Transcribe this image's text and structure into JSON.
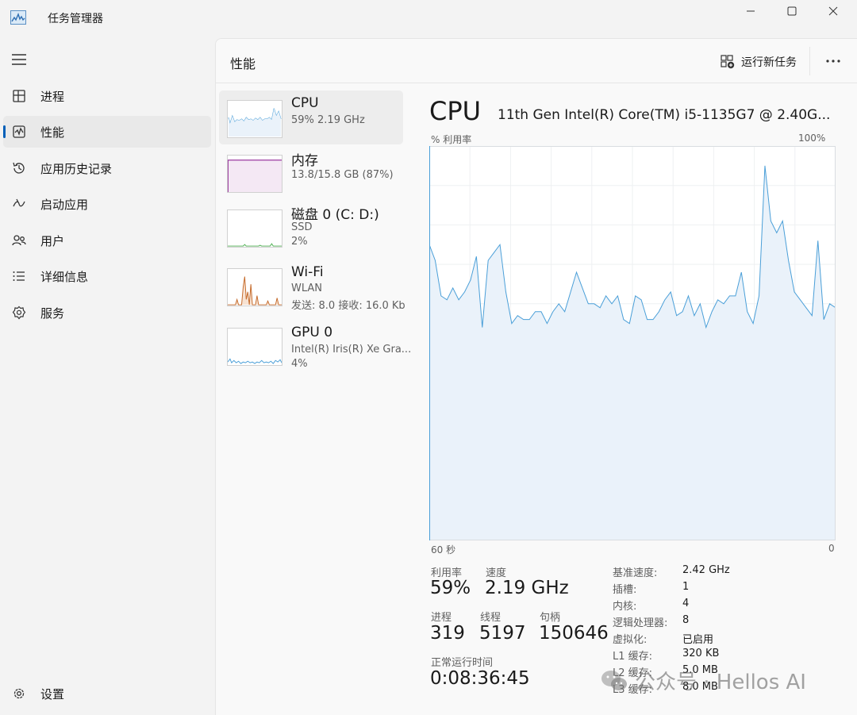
{
  "window": {
    "title": "任务管理器",
    "min_icon": "minimize-icon",
    "max_icon": "maximize-icon",
    "close_icon": "close-icon"
  },
  "sidebar": {
    "items": [
      {
        "label": "进程",
        "icon": "processes-icon"
      },
      {
        "label": "性能",
        "icon": "performance-icon",
        "active": true
      },
      {
        "label": "应用历史记录",
        "icon": "history-icon"
      },
      {
        "label": "启动应用",
        "icon": "startup-icon"
      },
      {
        "label": "用户",
        "icon": "users-icon"
      },
      {
        "label": "详细信息",
        "icon": "details-icon"
      },
      {
        "label": "服务",
        "icon": "services-icon"
      }
    ],
    "settings_label": "设置"
  },
  "header": {
    "title": "性能",
    "run_task_label": "运行新任务",
    "more_label": "···"
  },
  "devices": [
    {
      "name": "CPU",
      "line1": "59% 2.19 GHz",
      "line2": ""
    },
    {
      "name": "内存",
      "line1": "13.8/15.8 GB (87%)",
      "line2": ""
    },
    {
      "name": "磁盘 0 (C: D:)",
      "line1": "SSD",
      "line2": "2%"
    },
    {
      "name": "Wi-Fi",
      "line1": "WLAN",
      "line2": "发送: 8.0 接收: 16.0 Kb"
    },
    {
      "name": "GPU 0",
      "line1": "Intel(R) Iris(R) Xe Gra...",
      "line2": "4%"
    }
  ],
  "cpu": {
    "title": "CPU",
    "model": "11th Gen Intel(R) Core(TM) i5-1135G7 @ 2.40G...",
    "graph_left_label": "% 利用率",
    "graph_right_label": "100%",
    "axis_left": "60 秒",
    "axis_right": "0",
    "accent": "#4a9fd8",
    "fill": "#eaf2fa"
  },
  "chart_data": {
    "type": "area",
    "title": "% 利用率",
    "xlabel": "",
    "ylabel": "",
    "x_range": [
      "60 秒",
      "0"
    ],
    "ylim": [
      0,
      100
    ],
    "grid": true,
    "values": [
      75,
      71,
      62,
      61,
      64,
      61,
      63,
      66,
      72,
      54,
      71,
      73,
      75,
      63,
      55,
      57,
      56,
      56,
      58,
      58,
      55,
      58,
      60,
      58,
      63,
      68,
      64,
      60,
      60,
      59,
      62,
      60,
      62,
      56,
      55,
      62,
      61,
      56,
      56,
      58,
      61,
      63,
      57,
      58,
      62,
      57,
      60,
      54,
      58,
      61,
      60,
      62,
      62,
      68,
      58,
      55,
      62,
      95,
      81,
      78,
      81,
      71,
      63,
      61,
      59,
      57,
      76,
      56,
      60,
      59
    ]
  },
  "stats": {
    "util_label": "利用率",
    "util_value": "59%",
    "speed_label": "速度",
    "speed_value": "2.19 GHz",
    "proc_label": "进程",
    "proc_value": "319",
    "thread_label": "线程",
    "thread_value": "5197",
    "handle_label": "句柄",
    "handle_value": "150646",
    "uptime_label": "正常运行时间",
    "uptime_value": "0:08:36:45"
  },
  "specs": [
    {
      "label": "基准速度:",
      "value": "2.42 GHz"
    },
    {
      "label": "插槽:",
      "value": "1"
    },
    {
      "label": "内核:",
      "value": "4"
    },
    {
      "label": "逻辑处理器:",
      "value": "8"
    },
    {
      "label": "虚拟化:",
      "value": "已启用"
    },
    {
      "label": "L1 缓存:",
      "value": "320 KB"
    },
    {
      "label": "L2 缓存:",
      "value": "5.0 MB"
    },
    {
      "label": "L3 缓存:",
      "value": "8.0 MB"
    }
  ],
  "watermark": "公众号 · Hellos AI"
}
